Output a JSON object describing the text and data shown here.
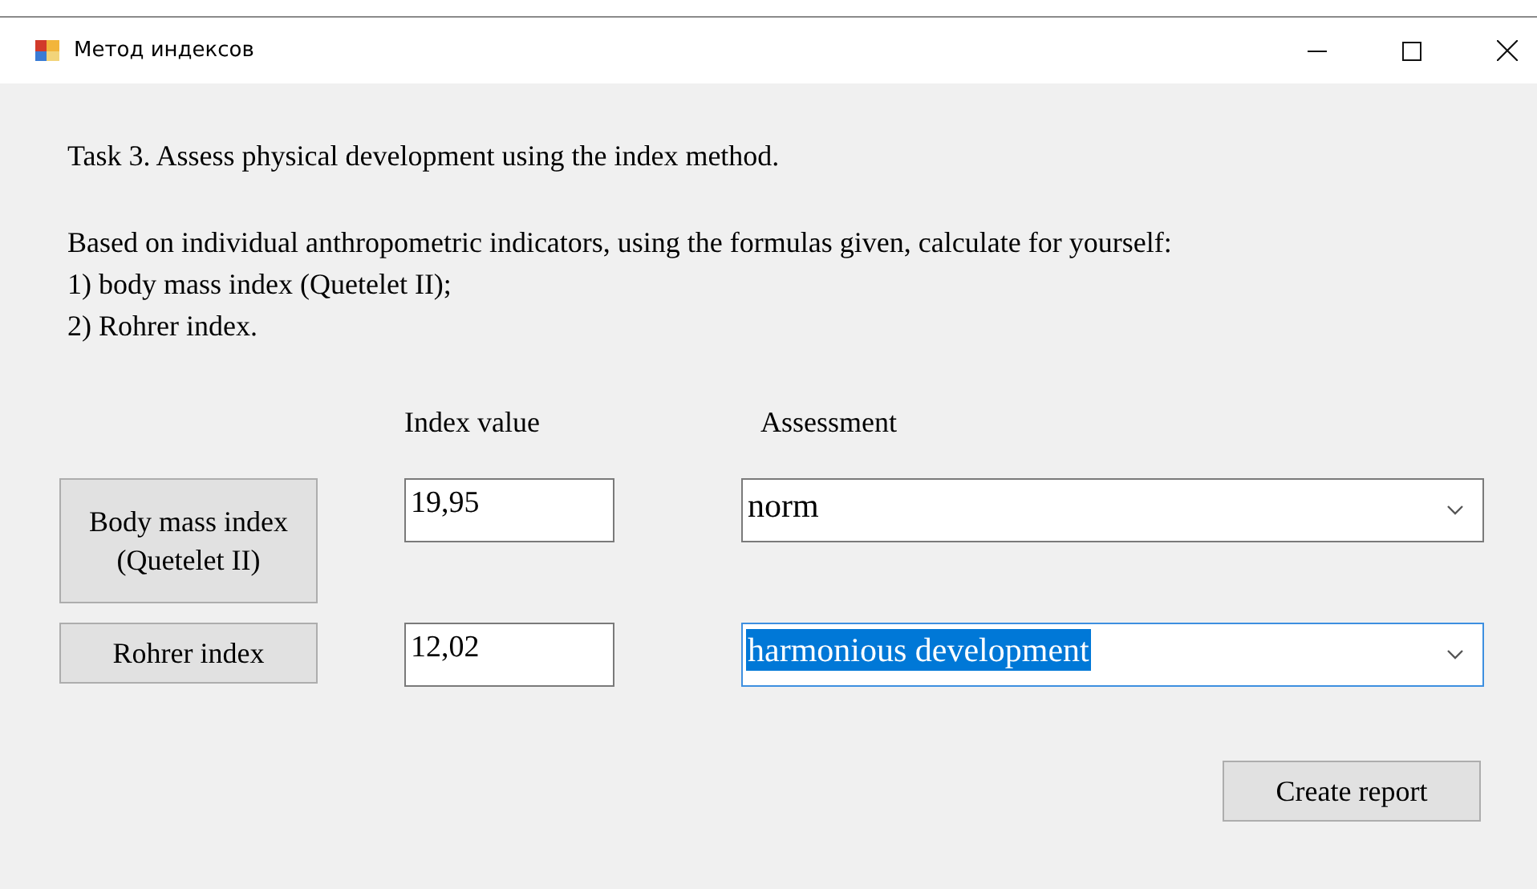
{
  "window": {
    "title": "Метод индексов"
  },
  "task": "Task 3. Assess physical development using the index method.",
  "instructions": [
    "Based on individual anthropometric indicators, using the formulas given, calculate for yourself:",
    "1) body mass index (Quetelet II);",
    "2) Rohrer index."
  ],
  "columns": [
    "Index value",
    "Assessment"
  ],
  "rows": [
    {
      "button": [
        "Body mass index",
        "(Quetelet II)"
      ],
      "value": "19,95",
      "assessment": "norm",
      "focused": false
    },
    {
      "button": [
        "Rohrer index"
      ],
      "value": "12,02",
      "assessment": "harmonious development",
      "focused": true
    }
  ],
  "report_button": "Create report"
}
